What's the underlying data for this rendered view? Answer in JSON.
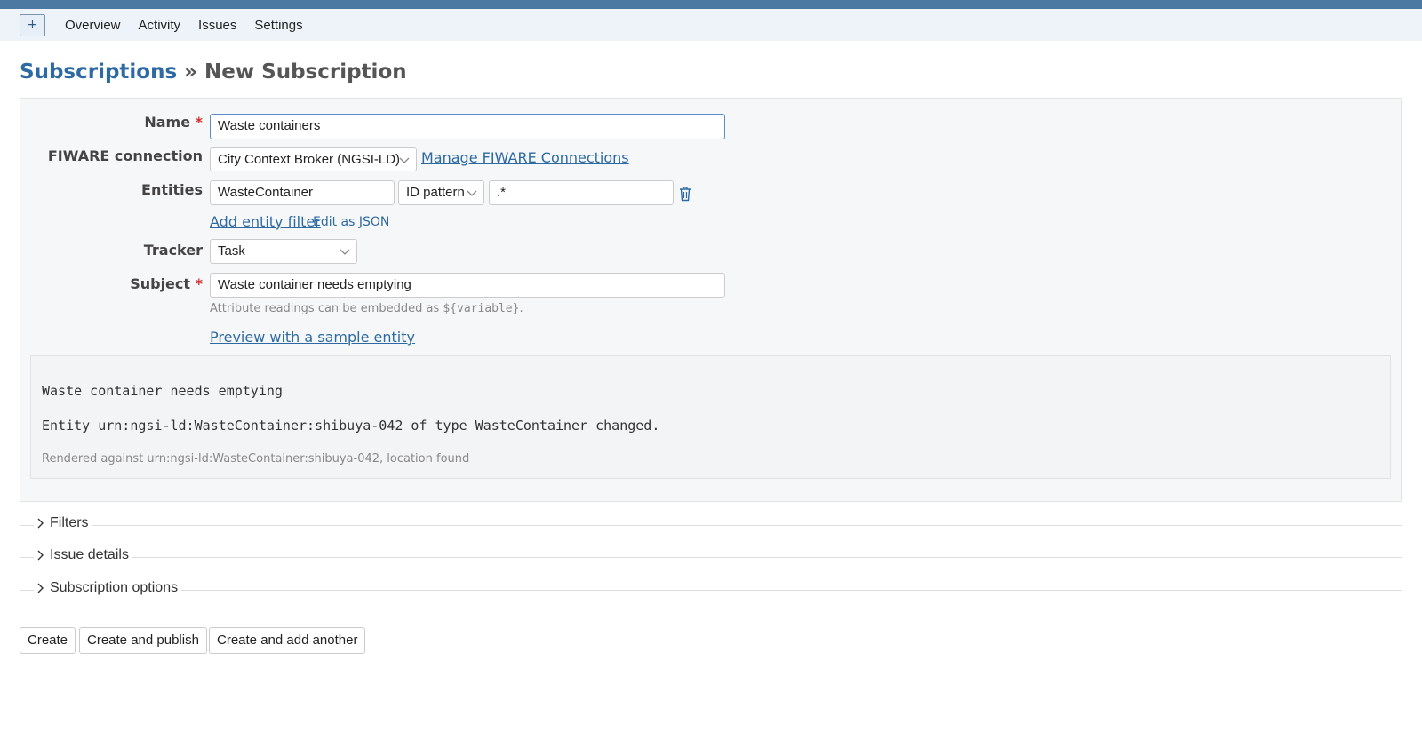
{
  "menu": {
    "new_label": "+",
    "items": [
      "Overview",
      "Activity",
      "Issues",
      "Settings"
    ]
  },
  "heading": {
    "parent": "Subscriptions",
    "separator": " » ",
    "current": "New Subscription"
  },
  "form": {
    "name": {
      "label": "Name",
      "required": "*",
      "value": "Waste containers"
    },
    "fiware": {
      "label": "FIWARE connection",
      "value": "City Context Broker (NGSI-LD)",
      "manage_link": "Manage FIWARE Connections"
    },
    "entities": {
      "label": "Entities",
      "type_value": "WasteContainer",
      "match_value": "ID pattern",
      "pattern_value": ".*",
      "add_link": "Add entity filter",
      "json_link": "Edit as JSON"
    },
    "tracker": {
      "label": "Tracker",
      "value": "Task"
    },
    "subject": {
      "label": "Subject",
      "required": "*",
      "value": "Waste container needs emptying",
      "hint_prefix": "Attribute readings can be embedded as ",
      "hint_code": "${variable}",
      "hint_suffix": ".",
      "preview_link": "Preview with a sample entity"
    }
  },
  "preview": {
    "line1": "Waste container needs emptying",
    "line2": "Entity urn:ngsi-ld:WasteContainer:shibuya-042 of type WasteContainer changed.",
    "note": "Rendered against urn:ngsi-ld:WasteContainer:shibuya-042, location found"
  },
  "sections": [
    "Filters",
    "Issue details",
    "Subscription options"
  ],
  "buttons": {
    "create": "Create",
    "create_publish": "Create and publish",
    "create_another": "Create and add another"
  }
}
